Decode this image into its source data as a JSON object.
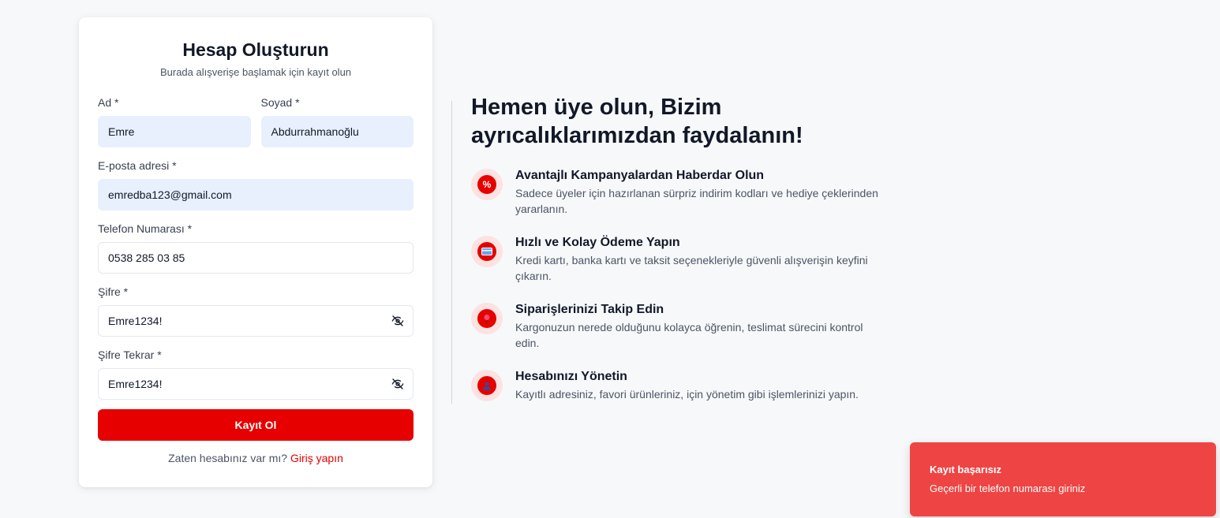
{
  "form": {
    "title": "Hesap Oluşturun",
    "subtitle": "Burada alışverişe başlamak için kayıt olun",
    "first_name": {
      "label": "Ad *",
      "value": "Emre"
    },
    "last_name": {
      "label": "Soyad *",
      "value": "Abdurrahmanoğlu"
    },
    "email": {
      "label": "E-posta adresi *",
      "value": "emredba123@gmail.com"
    },
    "phone": {
      "label": "Telefon Numarası *",
      "value": "0538 285 03 85"
    },
    "password": {
      "label": "Şifre *",
      "value": "Emre1234!",
      "icon": "eye-off-icon"
    },
    "password_confirm": {
      "label": "Şifre Tekrar *",
      "value": "Emre1234!",
      "icon": "eye-off-icon"
    },
    "submit_label": "Kayıt Ol",
    "login_prompt": "Zaten hesabınız var mı?",
    "login_link": "Giriş yapın"
  },
  "benefits": {
    "title": "Hemen üye olun, Bizim ayrıcalıklarımızdan faydalanın!",
    "items": [
      {
        "icon": "percent-icon",
        "title": "Avantajlı Kampanyalardan Haberdar Olun",
        "description": "Sadece üyeler için hazırlanan sürpriz indirim kodları ve hediye çeklerinden yararlanın."
      },
      {
        "icon": "credit-card-icon",
        "title": "Hızlı ve Kolay Ödeme Yapın",
        "description": "Kredi kartı, banka kartı ve taksit seçenekleriyle güvenli alışverişin keyfini çıkarın."
      },
      {
        "icon": "location-pin-icon",
        "title": "Siparişlerinizi Takip Edin",
        "description": "Kargonuzun nerede olduğunu kolayca öğrenin, teslimat sürecini kontrol edin."
      },
      {
        "icon": "user-icon",
        "title": "Hesabınızı Yönetin",
        "description": "Kayıtlı adresiniz, favori ürünleriniz, için yönetim gibi işlemlerinizi yapın."
      }
    ]
  },
  "toast": {
    "title": "Kayıt başarısız",
    "message": "Geçerli bir telefon numarası giriniz"
  },
  "colors": {
    "brand": "#e60000",
    "toast_bg": "#ef4444",
    "autofill_bg": "#e8f0fe",
    "icon_bg": "#fde2e2"
  }
}
